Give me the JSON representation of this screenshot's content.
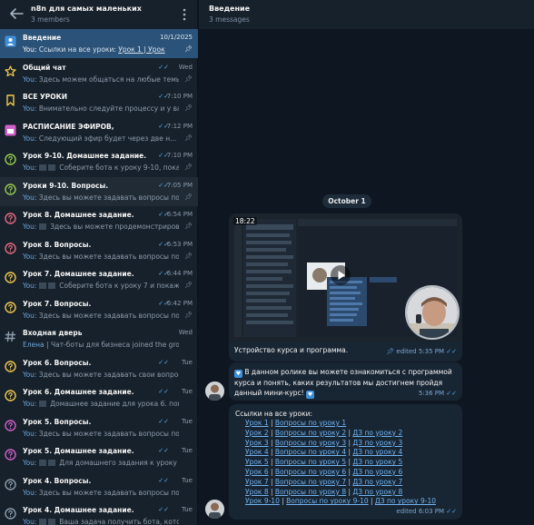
{
  "left": {
    "title": "n8n для самых маленьких",
    "subtitle": "3 members",
    "chats": [
      {
        "name": "Введение",
        "time": "10/1/2025",
        "you": "You:",
        "pre": "Ссылки на все уроки: ",
        "link": "Урок 1 | Урок",
        "selected": true,
        "pinned": true,
        "icon": "account-box-icon",
        "icon_color": "#3f8fd8"
      },
      {
        "name": "Общий чат",
        "time": "Wed",
        "you": "You:",
        "pre": "Здесь можем общаться на любые темы)",
        "pinned": true,
        "icon": "star-icon",
        "icon_color": "#f2c94c",
        "ticks": "✓✓"
      },
      {
        "name": "ВСЕ УРОКИ",
        "time": "7:10 PM",
        "you": "You:",
        "pre": "Внимательно следуйте процессу и у вас...",
        "pinned": true,
        "icon": "bookmark-icon",
        "icon_color": "#f2c94c",
        "ticks": "✓✓"
      },
      {
        "name": "РАСПИСАНИЕ ЭФИРОВ,",
        "time": "7:12 PM",
        "you": "You:",
        "pre": "Следующий эфир будет  через две н...",
        "pinned": true,
        "icon": "calendar-icon",
        "icon_color": "#d161c8",
        "ticks": "✓✓"
      },
      {
        "name": "Урок 9-10. Домашнее задание.",
        "time": "7:10 PM",
        "you": "You:",
        "pre": " Соберите бота к уроку 9-10, показ...",
        "pinned": true,
        "icon": "chat-question-icon",
        "icon_color": "#9bcc50",
        "ticks": "✓✓",
        "thumbs": 2
      },
      {
        "name": "Уроки 9-10. Вопросы.",
        "time": "7:05 PM",
        "you": "You:",
        "pre": "Здесь вы можете задавать вопросы по уро...",
        "pinned": true,
        "icon": "chat-question-icon",
        "icon_color": "#9bcc50",
        "ticks": "✓✓",
        "hover": true
      },
      {
        "name": "Урок 8. Домашнее задание.",
        "time": "6:54 PM",
        "you": "You:",
        "pre": " Здесь вы можете продемонстрирова...",
        "pinned": true,
        "icon": "chat-question-icon",
        "icon_color": "#e96a7f",
        "ticks": "✓✓",
        "thumbs": 1
      },
      {
        "name": "Урок 8. Вопросы.",
        "time": "6:53 PM",
        "you": "You:",
        "pre": "Здесь вы можете задавать вопросы по уро...",
        "pinned": true,
        "icon": "chat-question-icon",
        "icon_color": "#e96a7f",
        "ticks": "✓✓"
      },
      {
        "name": "Урок 7. Домашнее задание.",
        "time": "6:44 PM",
        "you": "You:",
        "pre": " Соберите бота к уроку 7 и покажи...",
        "pinned": true,
        "icon": "chat-question-icon",
        "icon_color": "#f2c94c",
        "ticks": "✓✓",
        "thumbs": 2
      },
      {
        "name": "Урок 7. Вопросы.",
        "time": "6:42 PM",
        "you": "You:",
        "pre": "Здесь вы можете задавать вопросы по уро...",
        "pinned": true,
        "icon": "chat-question-icon",
        "icon_color": "#f2c94c",
        "ticks": "✓✓"
      },
      {
        "name": "Входная дверь",
        "time": "Wed",
        "you": "Елена |",
        "pre": " Чат-боты для бизнеса joined the group vi...",
        "pinned": false,
        "icon": "hash-icon",
        "icon_color": "#8d9cab"
      },
      {
        "name": "Урок 6. Вопросы.",
        "time": "Tue",
        "you": "You:",
        "pre": "Здесь вы можете задавать свои вопросы к у...",
        "pinned": false,
        "icon": "chat-question-icon",
        "icon_color": "#f2c94c",
        "ticks": "✓✓"
      },
      {
        "name": "Урок 6. Домашнее задание.",
        "time": "Tue",
        "you": "You:",
        "pre": " Домашнее задание для урока 6. показать...",
        "pinned": false,
        "icon": "chat-question-icon",
        "icon_color": "#f2c94c",
        "ticks": "✓✓",
        "thumbs": 1
      },
      {
        "name": "Урок 5. Вопросы.",
        "time": "Tue",
        "you": "You:",
        "pre": "Здесь вы можете задавать вопросы по уро...",
        "pinned": false,
        "icon": "chat-question-icon",
        "icon_color": "#d161c8",
        "ticks": "✓✓"
      },
      {
        "name": "Урок 5. Домашнее задание.",
        "time": "Tue",
        "you": "You:",
        "pre": " Для домашнего задания к уроку 5...",
        "pinned": false,
        "icon": "chat-question-icon",
        "icon_color": "#d161c8",
        "ticks": "✓✓",
        "thumbs": 2
      },
      {
        "name": "Урок 4. Вопросы.",
        "time": "Tue",
        "you": "You:",
        "pre": "Здесь вы можете задавать вопросы по уро...",
        "pinned": false,
        "icon": "chat-question-icon",
        "icon_color": "#8d9cab",
        "ticks": "✓✓"
      },
      {
        "name": "Урок 4. Домашнее задание.",
        "time": "Tue",
        "you": "You:",
        "pre": " Ваша задача получить бота, которы...",
        "pinned": false,
        "icon": "chat-question-icon",
        "icon_color": "#8d9cab",
        "ticks": "✓✓",
        "thumbs": 2
      }
    ]
  },
  "right": {
    "title": "Введение",
    "subtitle": "3 messages",
    "date": "October 1",
    "video": {
      "time": "18:22",
      "caption": "Устройство курса и программа.",
      "meta": "edited 5:35 PM"
    },
    "text": {
      "body": "В данном ролике вы можете ознакомиться с программой курса и понять, каких результатов мы достигнем пройдя данный мини-курс!",
      "time": "5:36 PM"
    },
    "links": {
      "title": "Ссылки на все уроки:",
      "meta": "edited 6:03 PM",
      "rows": [
        [
          "Урок 1",
          "Вопросы по уроку 1"
        ],
        [
          "Урок 2",
          "Вопросы по уроку 2",
          "ДЗ по уроку 2"
        ],
        [
          "Урок 3",
          "Вопросы по уроку 3",
          "ДЗ по уроку 3"
        ],
        [
          "Урок 4",
          "Вопросы по уроку 4",
          "ДЗ по уроку 4"
        ],
        [
          "Урок 5",
          "Вопросы по уроку 5",
          "ДЗ по уроку 5"
        ],
        [
          "Урок 6",
          "Вопросы по уроку 6",
          "ДЗ по уроку 6"
        ],
        [
          "Урок 7",
          "Вопросы по уроку 7",
          "ДЗ по уроку 7"
        ],
        [
          "Урок 8",
          "Вопросы по уроку 8",
          "ДЗ по уроку 8"
        ],
        [
          "Урок 9-10",
          "Вопросы по уроку 9-10",
          "ДЗ по уроку 9-10"
        ]
      ]
    }
  }
}
